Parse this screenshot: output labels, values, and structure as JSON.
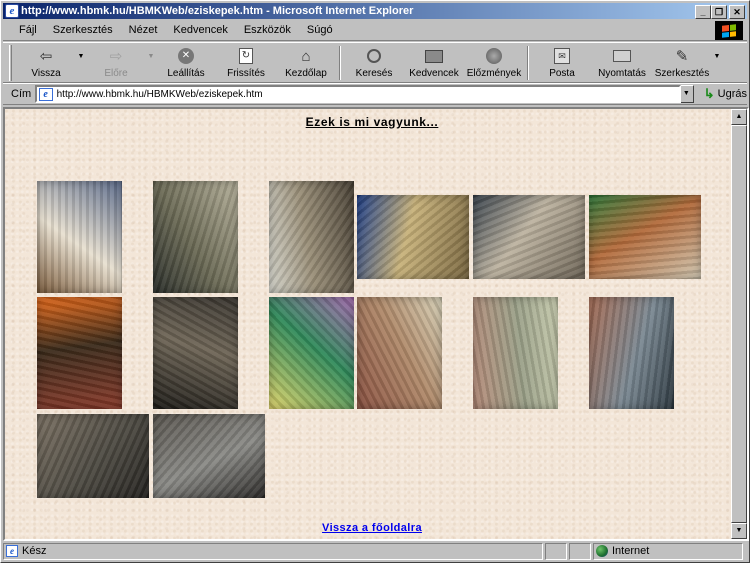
{
  "window": {
    "title": "http://www.hbmk.hu/HBMKWeb/eziskepek.htm - Microsoft Internet Explorer",
    "controls": [
      "minimize",
      "restore",
      "close"
    ]
  },
  "menubar": {
    "items": [
      {
        "label": "Fájl",
        "key": "F"
      },
      {
        "label": "Szerkesztés",
        "key": "S"
      },
      {
        "label": "Nézet",
        "key": "N"
      },
      {
        "label": "Kedvencek",
        "key": "d"
      },
      {
        "label": "Eszközök",
        "key": "E"
      },
      {
        "label": "Súgó",
        "key": "S"
      }
    ]
  },
  "toolbar": {
    "back": "Vissza",
    "forward": "Előre",
    "stop": "Leállítás",
    "refresh": "Frissítés",
    "home": "Kezdőlap",
    "search": "Keresés",
    "favorites": "Kedvencek",
    "history": "Előzmények",
    "mail": "Posta",
    "print": "Nyomtatás",
    "edit": "Szerkesztés"
  },
  "addressbar": {
    "label": "Cím",
    "url": "http://www.hbmk.hu/HBMKWeb/eziskepek.htm",
    "go_label": "Ugrás"
  },
  "page": {
    "heading": "Ezek is mi vagyunk...",
    "home_link": "Vissza a főoldalra",
    "photos": [
      {
        "subject": "office shelves with drawers",
        "colors": [
          "#7a5a3a",
          "#e8e0d0",
          "#5a6a8a"
        ]
      },
      {
        "subject": "library book stacks",
        "colors": [
          "#2a2e2a",
          "#6b6a55",
          "#b5b09a"
        ]
      },
      {
        "subject": "white bathroom sink",
        "colors": [
          "#d5d5cc",
          "#9a8f78",
          "#4a4236"
        ]
      },
      {
        "subject": "ornate building facade",
        "colors": [
          "#1e3f8a",
          "#c8b27a",
          "#7a6740"
        ]
      },
      {
        "subject": "balcony of building",
        "colors": [
          "#39434d",
          "#bdb3a0",
          "#6d6456"
        ]
      },
      {
        "subject": "green machinery in workshop",
        "colors": [
          "#2f7a3a",
          "#b36a3a",
          "#d0c6b0"
        ]
      },
      {
        "subject": "office with orange device",
        "colors": [
          "#e86a1a",
          "#3a2a1a",
          "#8a3a2a"
        ]
      },
      {
        "subject": "dark floor grating",
        "colors": [
          "#3a3630",
          "#6e6556",
          "#1e1c18"
        ]
      },
      {
        "subject": "stained glass window",
        "colors": [
          "#a56ab0",
          "#2f8a5a",
          "#e0d56a"
        ]
      },
      {
        "subject": "damaged ceiling plaster",
        "colors": [
          "#d8d2b8",
          "#b08a6a",
          "#8a5040"
        ]
      },
      {
        "subject": "stained wall and ledge",
        "colors": [
          "#c8ccae",
          "#9aa088",
          "#b58a78"
        ]
      },
      {
        "subject": "boiler room pipes",
        "colors": [
          "#2e3a42",
          "#7a8892",
          "#a56a52"
        ]
      },
      {
        "subject": "ornate iron stove",
        "colors": [
          "#252320",
          "#4d4a42",
          "#7a7062"
        ]
      },
      {
        "subject": "industrial machine in basement",
        "colors": [
          "#2e2c2a",
          "#8a8a86",
          "#5a5650"
        ]
      }
    ]
  },
  "status": {
    "text": "Kész",
    "zone": "Internet"
  }
}
